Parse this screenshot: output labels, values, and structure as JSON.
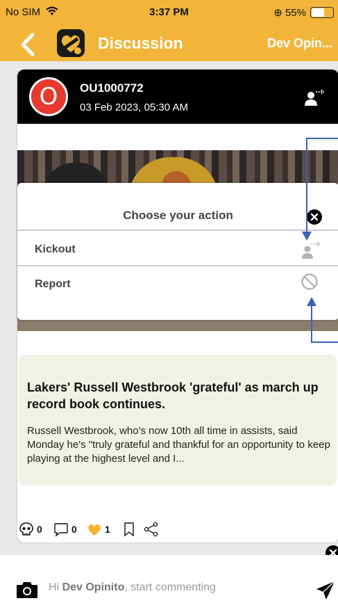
{
  "status_bar": {
    "carrier": "No SIM",
    "time": "3:37 PM",
    "battery_percent": "55%",
    "battery_level": 0.55
  },
  "nav": {
    "title": "Discussion",
    "right_title": "Dev Opin..."
  },
  "post": {
    "user_id": "OU1000772",
    "avatar_letter": "O",
    "date": "03 Feb 2023, 05:30 AM",
    "news_title": "Lakers' Russell Westbrook 'grateful' as march up record book continues.",
    "news_body": "Russell Westbrook, who's now 10th all time in assists, said Monday he's \"truly grateful and thankful for an opportunity to keep playing at the highest level and I..."
  },
  "reactions": {
    "skull_count": "0",
    "comment_count": "0",
    "heart_count": "1"
  },
  "action_sheet": {
    "title": "Choose your action",
    "kickout_label": "Kickout",
    "report_label": "Report"
  },
  "comment_bar": {
    "prefix": "Hi ",
    "user_name": "Dev Opinito",
    "suffix": ", start commenting"
  },
  "colors": {
    "brand": "#f2b53a",
    "avatar": "#e8392e",
    "heart": "#f4b537",
    "arrow": "#3a64b8"
  }
}
